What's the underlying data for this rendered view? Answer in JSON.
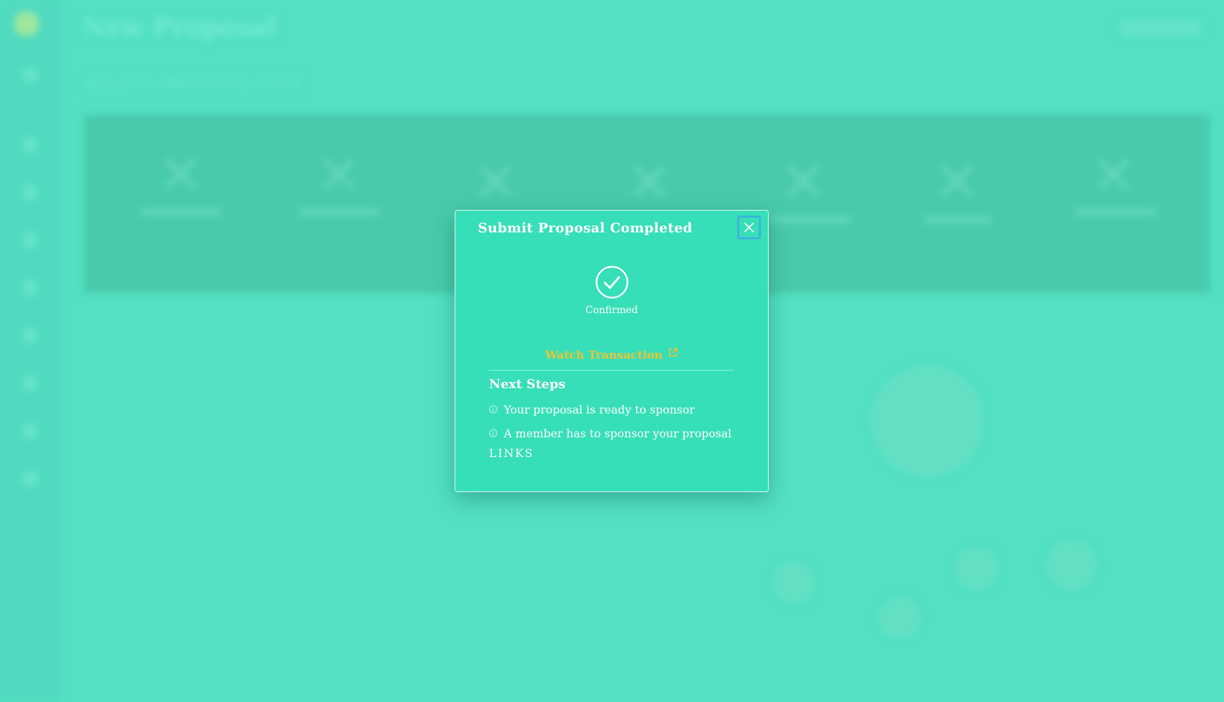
{
  "background": {
    "page_title": "New Proposal",
    "section_title": "SELECT PROPOSAL TYPE"
  },
  "modal": {
    "title": "Submit Proposal Completed",
    "close_icon": "close-icon",
    "status": {
      "icon": "check-circle-icon",
      "label": "Confirmed"
    },
    "watch_link": {
      "label": "Watch Transaction",
      "icon": "external-link-icon"
    },
    "next_steps": {
      "title": "Next Steps",
      "items": [
        {
          "icon": "info-icon",
          "text": "Your proposal is ready to sponsor"
        },
        {
          "icon": "info-icon",
          "text": "A member has to sponsor your proposal"
        }
      ],
      "links_label": "LINKS"
    }
  },
  "colors": {
    "background": "#52e0c3",
    "modal": "#36dfb8",
    "link": "#f0c233",
    "close_outline": "#3bb4d9"
  }
}
